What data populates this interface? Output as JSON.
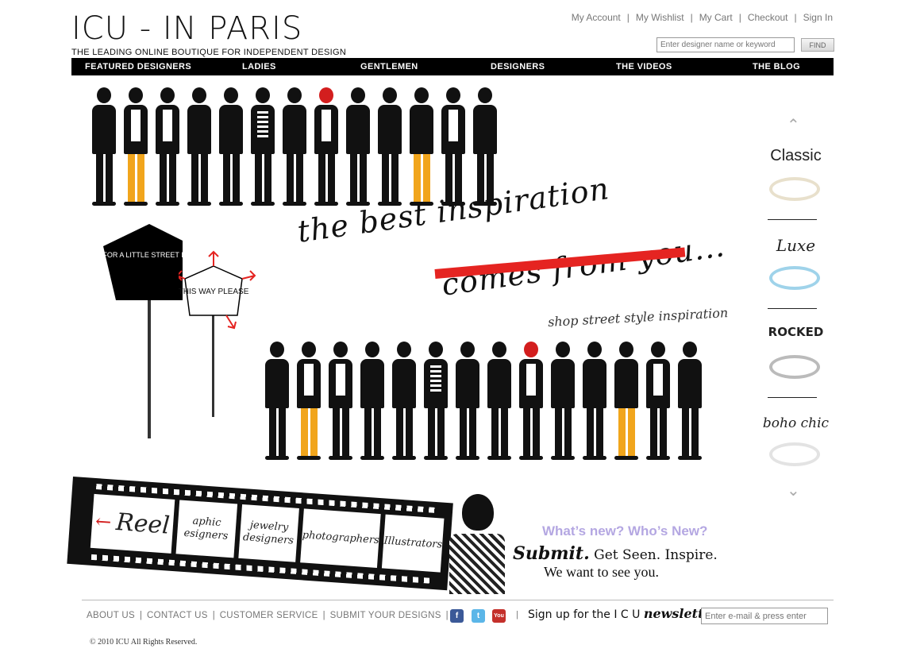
{
  "brand": {
    "title": "ICU - IN PARIS",
    "tagline": "THE LEADING ONLINE BOUTIQUE FOR INDEPENDENT DESIGN"
  },
  "account_links": [
    "My Account",
    "My Wishlist",
    "My Cart",
    "Checkout",
    "Sign In"
  ],
  "search": {
    "placeholder": "Enter designer name or keyword",
    "button_label": "FIND"
  },
  "nav": [
    "FEATURED DESIGNERS",
    "LADIES",
    "GENTLEMEN",
    "DESIGNERS",
    "THE VIDEOS",
    "THE BLOG"
  ],
  "hero": {
    "sign_1": "LOOKING FOR A LITTLE STREET INSPIRATION?",
    "sign_2": "THIS WAY PLEASE",
    "tagline_line1": "the best inspiration",
    "tagline_line2": "comes from you...",
    "subline": "shop street style inspiration"
  },
  "sidebar": {
    "categories": [
      "Classic",
      "Luxe",
      "ROCKED",
      "boho chic"
    ]
  },
  "reel": {
    "title": "Reel",
    "frames": [
      "aphic esigners",
      "jewelry designers",
      "photographers",
      "Illustrators"
    ]
  },
  "promo": {
    "whats_new": "What’s new? Who’s New?",
    "submit_word": "Submit.",
    "submit_rest": " Get Seen. Inspire.",
    "want": "We want to see you."
  },
  "footer": {
    "links": [
      "ABOUT US",
      "CONTACT US",
      "CUSTOMER SERVICE",
      "SUBMIT YOUR DESIGNS"
    ],
    "social": {
      "facebook": "f",
      "twitter": "t",
      "youtube": "You Tube"
    },
    "newsletter_prefix": "Sign up for the I C U ",
    "newsletter_word": "newsletter",
    "newsletter_placeholder": "Enter e-mail & press enter",
    "copyright": "© 2010 ICU All Rights Reserved."
  },
  "colors": {
    "accent_red": "#e52421",
    "leg_yellow": "#f1a51c",
    "whats_new_lilac": "#b4a7e2"
  }
}
